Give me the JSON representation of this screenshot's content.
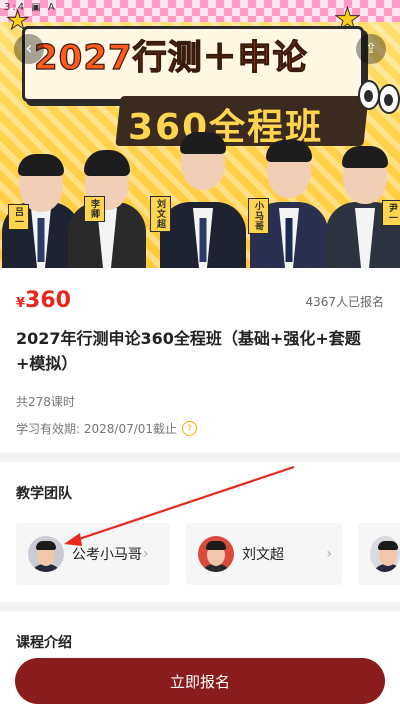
{
  "statusbar": "3:4 ▣ A",
  "banner": {
    "title_line1": "2027行测＋申论",
    "title_line2": "360全程班",
    "teacher_tags": [
      "吕一",
      "李卿",
      "刘文超",
      "小马哥",
      "尹一"
    ]
  },
  "course": {
    "price_currency": "¥",
    "price": "360",
    "enrolled": "4367人已报名",
    "title": "2027年行测申论360全程班（基础+强化+套题+模拟）",
    "lessons": "共278课时",
    "validity": "学习有效期: 2028/07/01截止"
  },
  "team": {
    "heading": "教学团队",
    "teachers": [
      {
        "name": "公考小马哥"
      },
      {
        "name": "刘文超"
      }
    ]
  },
  "intro": {
    "heading": "课程介绍"
  },
  "cta": {
    "label": "立即报名"
  },
  "colors": {
    "price": "#e8281e",
    "cta": "#8b1c1c",
    "annotation_arrow": "#e8281e"
  }
}
